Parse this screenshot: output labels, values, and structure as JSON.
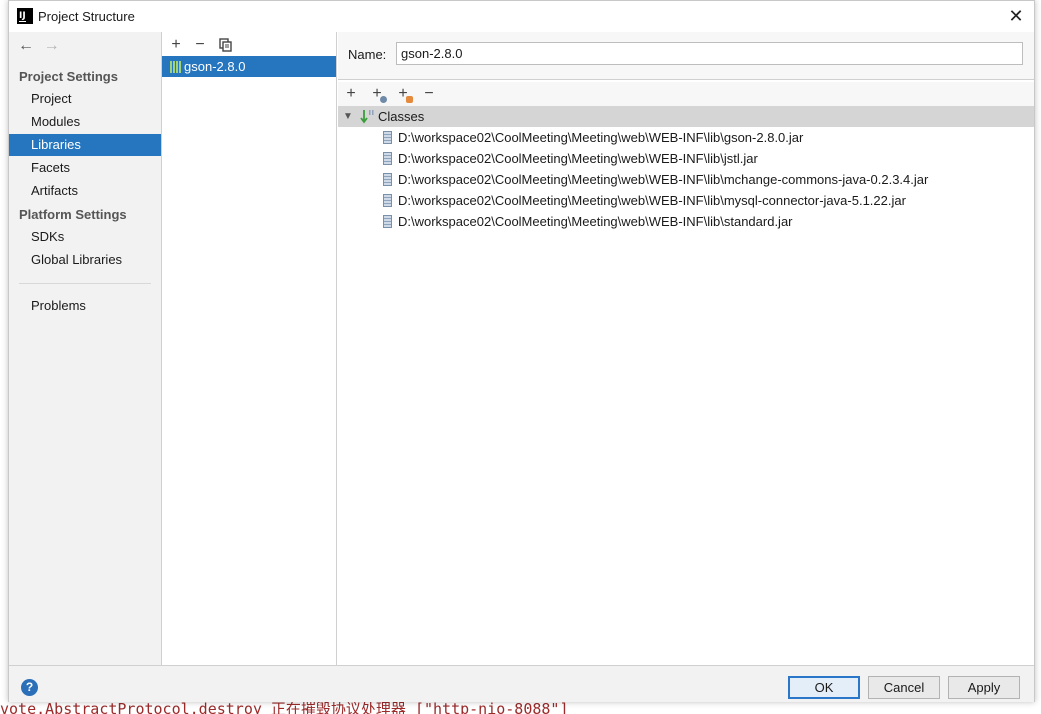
{
  "window": {
    "title": "Project Structure",
    "close_glyph": "✕"
  },
  "nav": {
    "back_glyph": "←",
    "forward_glyph": "→"
  },
  "sidebar": {
    "project_settings_heading": "Project Settings",
    "project_items": [
      {
        "label": "Project"
      },
      {
        "label": "Modules"
      },
      {
        "label": "Libraries",
        "selected": true
      },
      {
        "label": "Facets"
      },
      {
        "label": "Artifacts"
      }
    ],
    "platform_settings_heading": "Platform Settings",
    "platform_items": [
      {
        "label": "SDKs"
      },
      {
        "label": "Global Libraries"
      }
    ],
    "problems_label": "Problems"
  },
  "libraries_toolbar": {
    "add": "+",
    "remove": "−",
    "copy_icon": "copy-icon"
  },
  "libraries": [
    {
      "label": "gson-2.8.0",
      "selected": true
    }
  ],
  "detail": {
    "name_label": "Name:",
    "name_value": "gson-2.8.0",
    "toolbar": {
      "add": "+",
      "add_alt": "+",
      "add_other": "+",
      "remove": "−"
    },
    "tree": {
      "root_label": "Classes",
      "items": [
        "D:\\workspace02\\CoolMeeting\\Meeting\\web\\WEB-INF\\lib\\gson-2.8.0.jar",
        "D:\\workspace02\\CoolMeeting\\Meeting\\web\\WEB-INF\\lib\\jstl.jar",
        "D:\\workspace02\\CoolMeeting\\Meeting\\web\\WEB-INF\\lib\\mchange-commons-java-0.2.3.4.jar",
        "D:\\workspace02\\CoolMeeting\\Meeting\\web\\WEB-INF\\lib\\mysql-connector-java-5.1.22.jar",
        "D:\\workspace02\\CoolMeeting\\Meeting\\web\\WEB-INF\\lib\\standard.jar"
      ]
    }
  },
  "buttons": {
    "help": "?",
    "ok": "OK",
    "cancel": "Cancel",
    "apply": "Apply"
  },
  "background_text": {
    "bottom_line": "vote.AbstractProtocol.destroy 正在摧毁协议处理器 [\"http-nio-8088\"]"
  },
  "colors": {
    "selection": "#2675bf",
    "sidebar_bg": "#f2f2f2",
    "tree_root_bg": "#d5d5d5",
    "help_blue": "#2a6fb8"
  }
}
